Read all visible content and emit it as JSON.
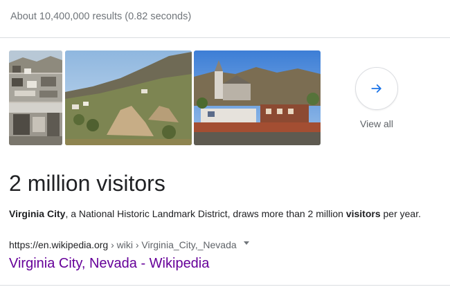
{
  "results_stats": "About 10,400,000 results (0.82 seconds)",
  "images": {
    "view_all_label": "View all",
    "items": [
      {
        "alt": "Historic photo collage of Virginia City"
      },
      {
        "alt": "Virginia City hillside with mine tailings"
      },
      {
        "alt": "Virginia City church and town buildings"
      }
    ]
  },
  "featured_answer": "2 million visitors",
  "snippet": {
    "bold_start": "Virginia City",
    "text_mid": ", a National Historic Landmark District, draws more than 2 million ",
    "bold_end": "visitors",
    "text_end": " per year."
  },
  "source": {
    "domain": "https://en.wikipedia.org",
    "path": " › wiki › Virginia_City,_Nevada",
    "title": "Virginia City, Nevada - Wikipedia"
  },
  "colors": {
    "accent": "#1a73e8",
    "visited_link": "#660099",
    "muted_text": "#70757a"
  },
  "icons": [
    "arrow-right-icon",
    "caret-down-icon"
  ]
}
